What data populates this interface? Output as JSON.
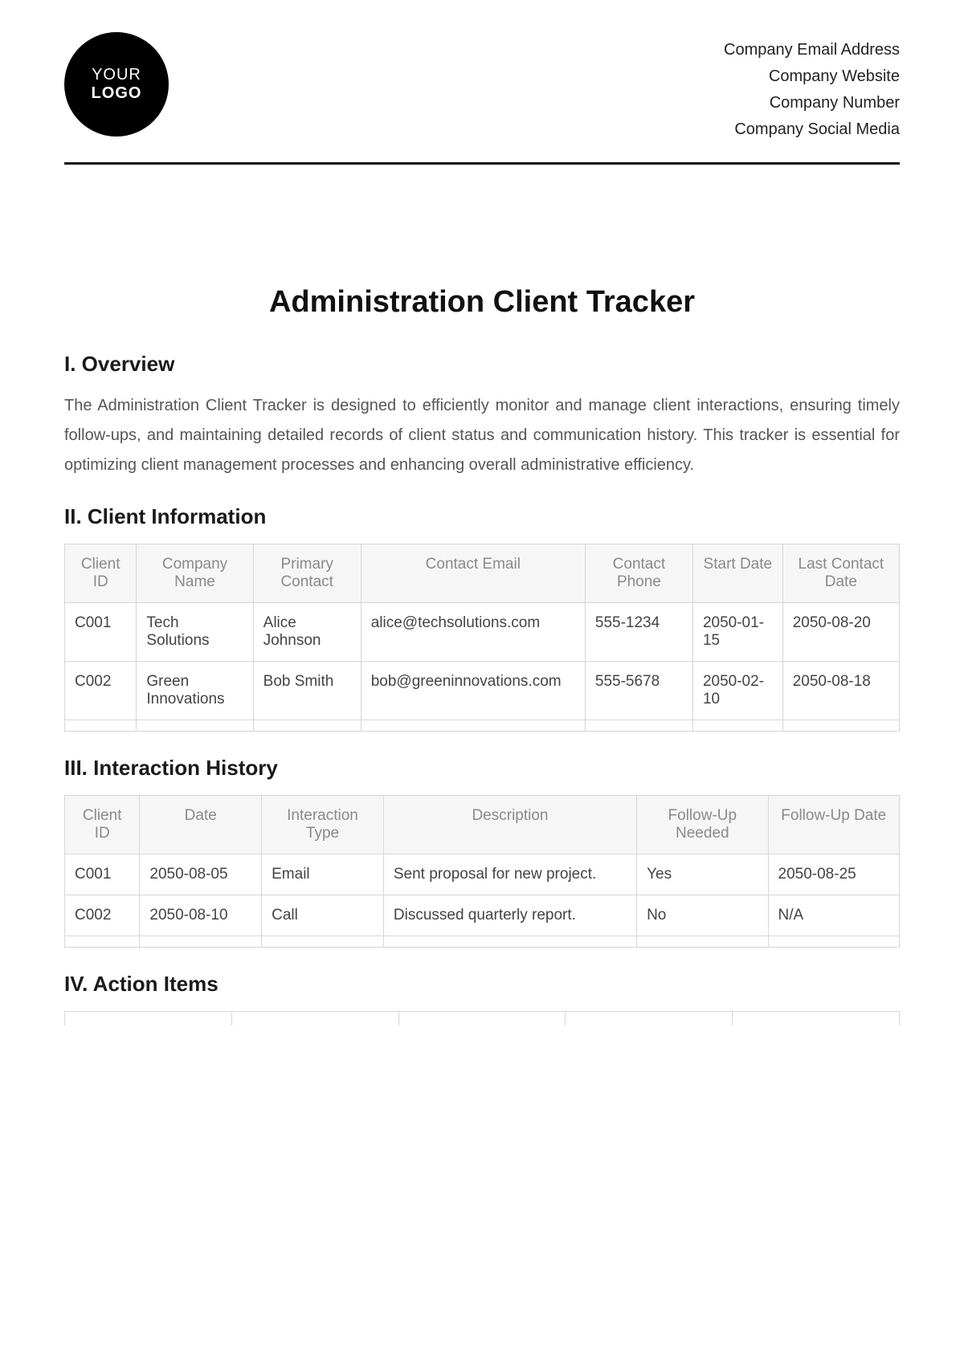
{
  "header": {
    "logo_line1": "YOUR",
    "logo_line2": "LOGO",
    "company_lines": [
      "Company Email Address",
      "Company Website",
      "Company Number",
      "Company Social Media"
    ]
  },
  "title": "Administration Client Tracker",
  "sections": {
    "overview": {
      "heading": "I. Overview",
      "text": "The Administration Client Tracker is designed to efficiently monitor and manage client interactions, ensuring timely follow-ups, and maintaining detailed records of client status and communication history. This tracker is essential for optimizing client management processes and enhancing overall administrative efficiency."
    },
    "client_info": {
      "heading": "II. Client Information",
      "columns": [
        "Client ID",
        "Company Name",
        "Primary Contact",
        "Contact Email",
        "Contact Phone",
        "Start Date",
        "Last Contact Date"
      ],
      "rows": [
        {
          "id": "C001",
          "company": "Tech Solutions",
          "contact": "Alice Johnson",
          "email": "alice@techsolutions.com",
          "phone": "555-1234",
          "start": "2050-01-15",
          "last": "2050-08-20"
        },
        {
          "id": "C002",
          "company": "Green Innovations",
          "contact": "Bob Smith",
          "email": "bob@greeninnovations.com",
          "phone": "555-5678",
          "start": "2050-02-10",
          "last": "2050-08-18"
        }
      ]
    },
    "interaction": {
      "heading": "III. Interaction History",
      "columns": [
        "Client ID",
        "Date",
        "Interaction Type",
        "Description",
        "Follow-Up Needed",
        "Follow-Up Date"
      ],
      "rows": [
        {
          "id": "C001",
          "date": "2050-08-05",
          "type": "Email",
          "desc": "Sent proposal for new project.",
          "fu": "Yes",
          "fud": "2050-08-25"
        },
        {
          "id": "C002",
          "date": "2050-08-10",
          "type": "Call",
          "desc": "Discussed quarterly report.",
          "fu": "No",
          "fud": "N/A"
        }
      ]
    },
    "action": {
      "heading": "IV. Action Items"
    }
  }
}
